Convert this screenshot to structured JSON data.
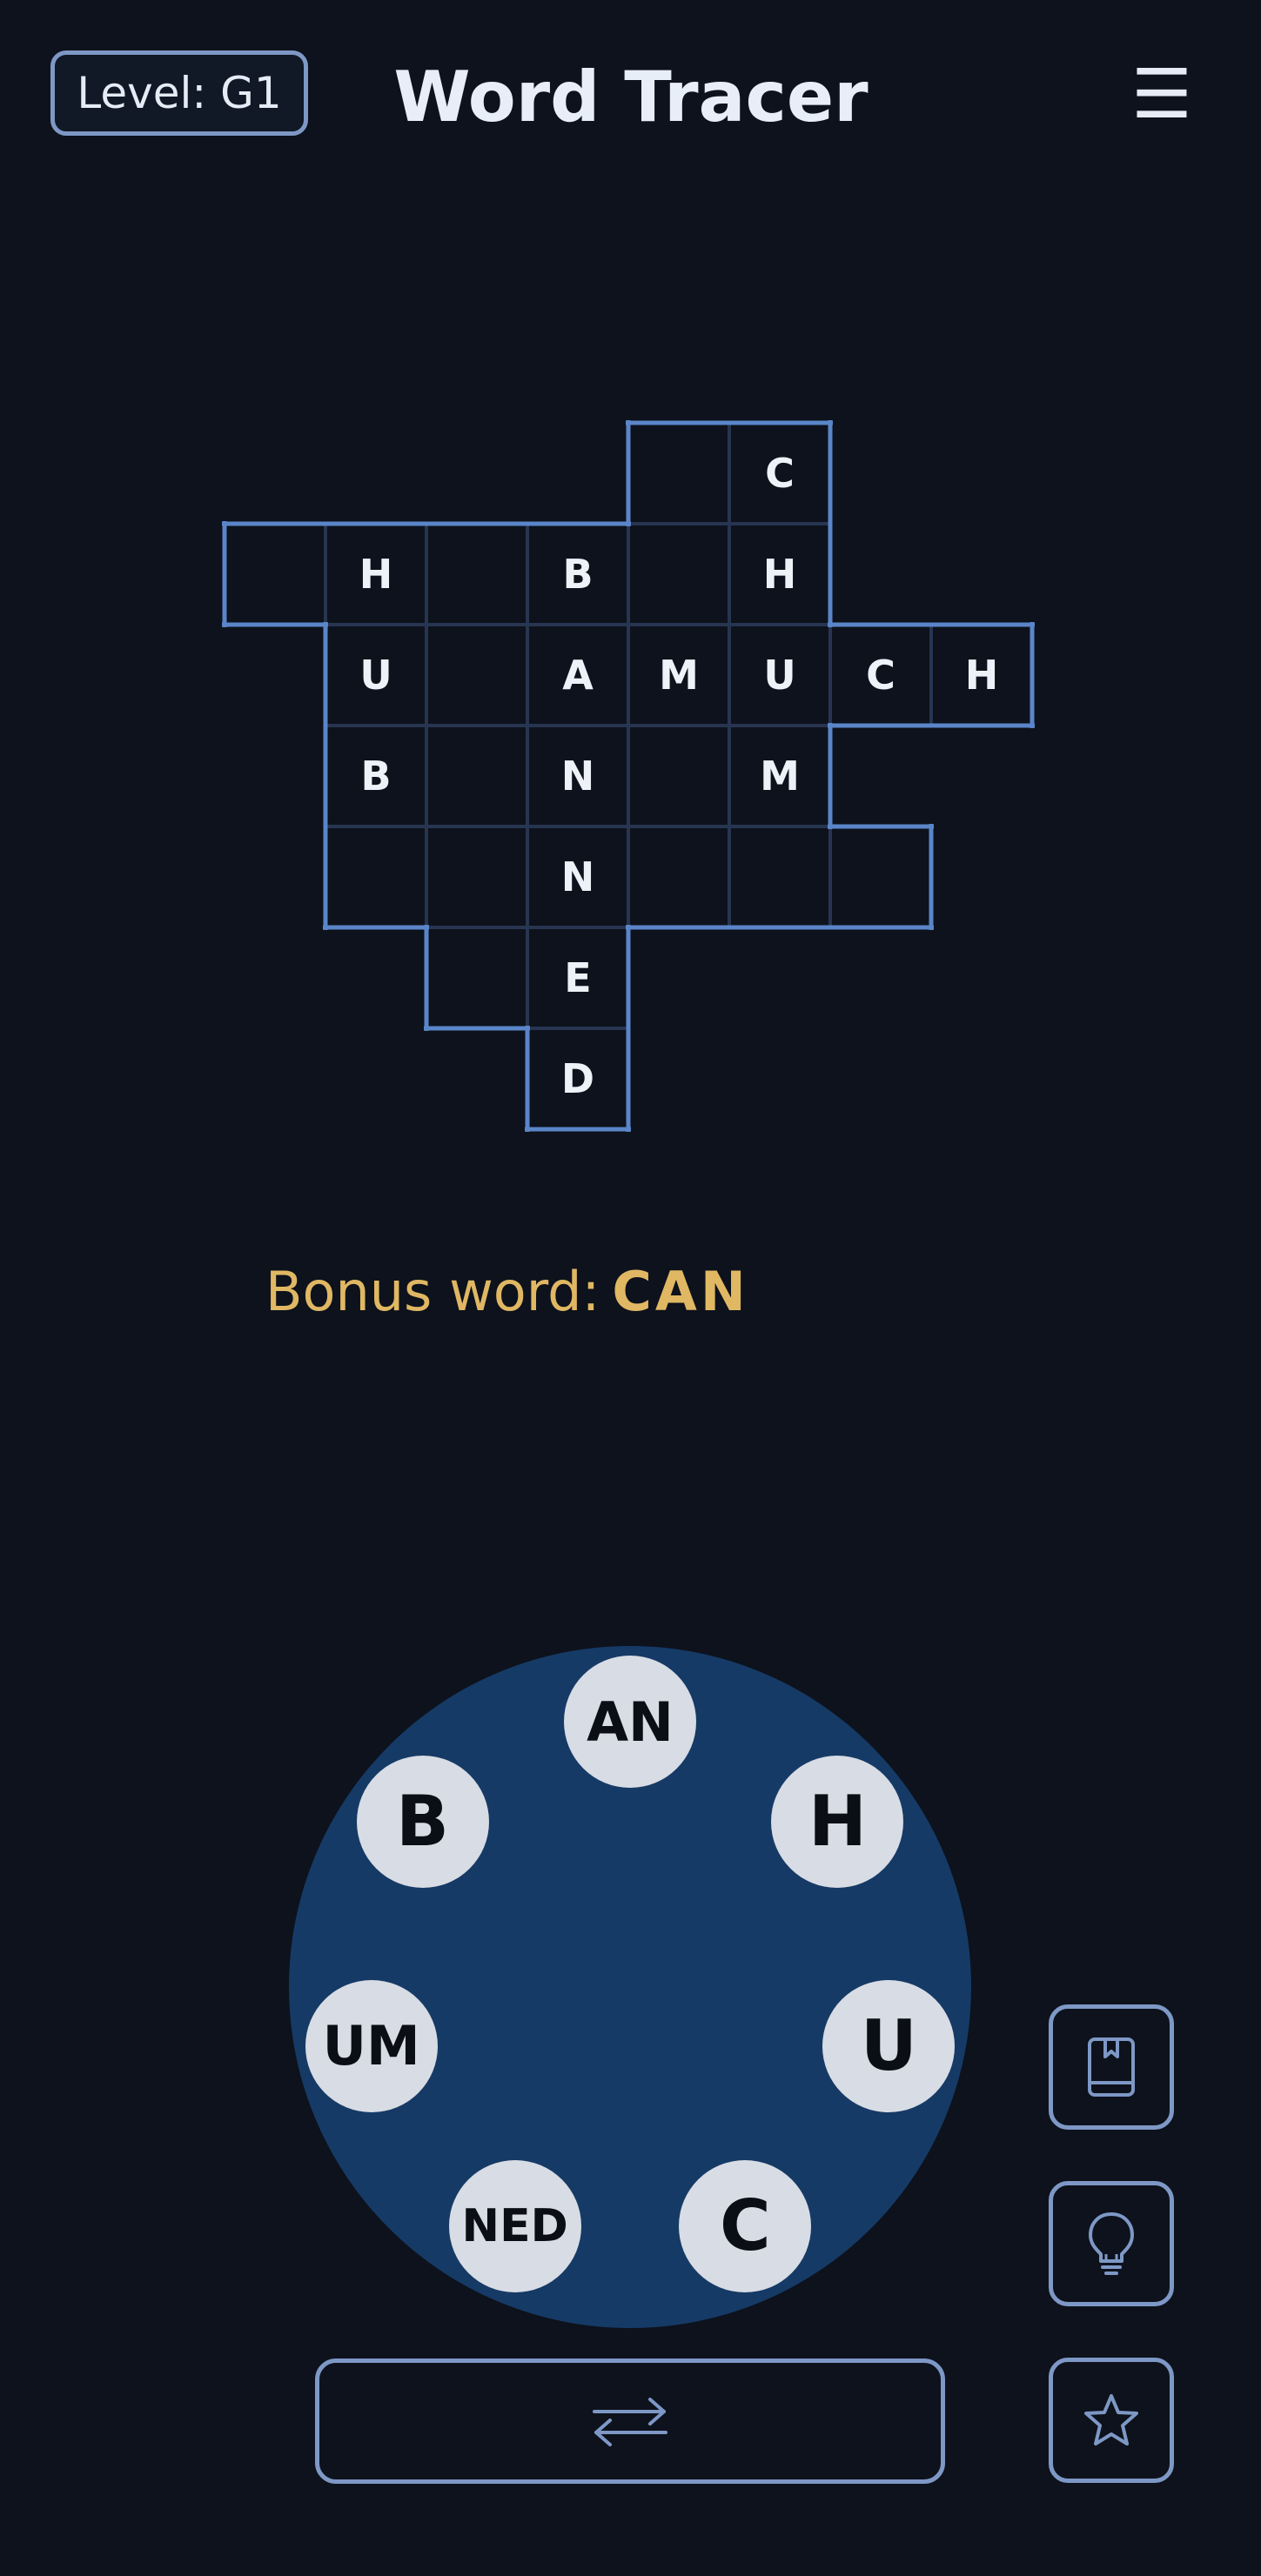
{
  "header": {
    "level_label": "Level: G1",
    "title": "Word Tracer",
    "menu_glyph": "☰"
  },
  "grid": {
    "cells": [
      {
        "row": 0,
        "col": 4,
        "letter": ""
      },
      {
        "row": 0,
        "col": 5,
        "letter": "C"
      },
      {
        "row": 1,
        "col": 0,
        "letter": ""
      },
      {
        "row": 1,
        "col": 1,
        "letter": "H"
      },
      {
        "row": 1,
        "col": 2,
        "letter": ""
      },
      {
        "row": 1,
        "col": 3,
        "letter": "B"
      },
      {
        "row": 1,
        "col": 4,
        "letter": ""
      },
      {
        "row": 1,
        "col": 5,
        "letter": "H"
      },
      {
        "row": 2,
        "col": 1,
        "letter": "U"
      },
      {
        "row": 2,
        "col": 2,
        "letter": ""
      },
      {
        "row": 2,
        "col": 3,
        "letter": "A"
      },
      {
        "row": 2,
        "col": 4,
        "letter": "M"
      },
      {
        "row": 2,
        "col": 5,
        "letter": "U"
      },
      {
        "row": 2,
        "col": 6,
        "letter": "C"
      },
      {
        "row": 2,
        "col": 7,
        "letter": "H"
      },
      {
        "row": 3,
        "col": 1,
        "letter": "B"
      },
      {
        "row": 3,
        "col": 2,
        "letter": ""
      },
      {
        "row": 3,
        "col": 3,
        "letter": "N"
      },
      {
        "row": 3,
        "col": 4,
        "letter": ""
      },
      {
        "row": 3,
        "col": 5,
        "letter": "M"
      },
      {
        "row": 4,
        "col": 1,
        "letter": ""
      },
      {
        "row": 4,
        "col": 2,
        "letter": ""
      },
      {
        "row": 4,
        "col": 3,
        "letter": "N"
      },
      {
        "row": 4,
        "col": 4,
        "letter": ""
      },
      {
        "row": 4,
        "col": 5,
        "letter": ""
      },
      {
        "row": 4,
        "col": 6,
        "letter": ""
      },
      {
        "row": 5,
        "col": 2,
        "letter": ""
      },
      {
        "row": 5,
        "col": 3,
        "letter": "E"
      },
      {
        "row": 6,
        "col": 3,
        "letter": "D"
      }
    ]
  },
  "bonus": {
    "label": "Bonus word:",
    "word": "CAN"
  },
  "wheel": {
    "tiles": [
      {
        "text": "AN"
      },
      {
        "text": "H"
      },
      {
        "text": "U"
      },
      {
        "text": "C"
      },
      {
        "text": "NED"
      },
      {
        "text": "UM"
      },
      {
        "text": "B"
      }
    ]
  },
  "icons": {
    "dictionary": "book-icon",
    "hint": "lightbulb-icon",
    "favorite": "star-icon",
    "shuffle": "shuffle-arrows-icon"
  },
  "colors": {
    "background": "#0d121c",
    "grid_outline": "#5a85c9",
    "bonus_text": "#e0b763",
    "wheel": "#163a66",
    "tile": "#d8dce4",
    "button_border": "#7e98c6"
  }
}
